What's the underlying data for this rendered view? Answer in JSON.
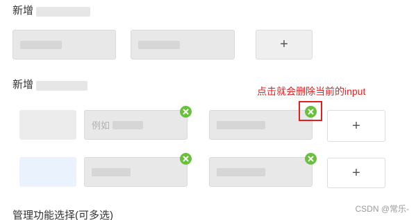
{
  "sections": {
    "add_field_title": "新增",
    "add_field_items_title": "新增",
    "function_select_title": "管理功能选择(可多选)"
  },
  "group1": {
    "inputs": [
      {
        "value": ""
      },
      {
        "value": ""
      }
    ],
    "add_label": "+"
  },
  "group2": {
    "rows": [
      {
        "inputs": [
          {
            "value": "例如"
          },
          {
            "value": ""
          }
        ],
        "add_label": "+"
      },
      {
        "inputs": [
          {
            "value": ""
          },
          {
            "value": ""
          }
        ],
        "add_label": "+"
      }
    ]
  },
  "annotation": {
    "text": "点击就会删除当前的input"
  },
  "watermark": "CSDN @常乐-",
  "colors": {
    "delete_icon": "#67c23a",
    "annotation": "#e02020",
    "input_bg": "#e8e8e8"
  },
  "icons": {
    "delete": "close-circle-icon",
    "add": "plus-icon"
  }
}
